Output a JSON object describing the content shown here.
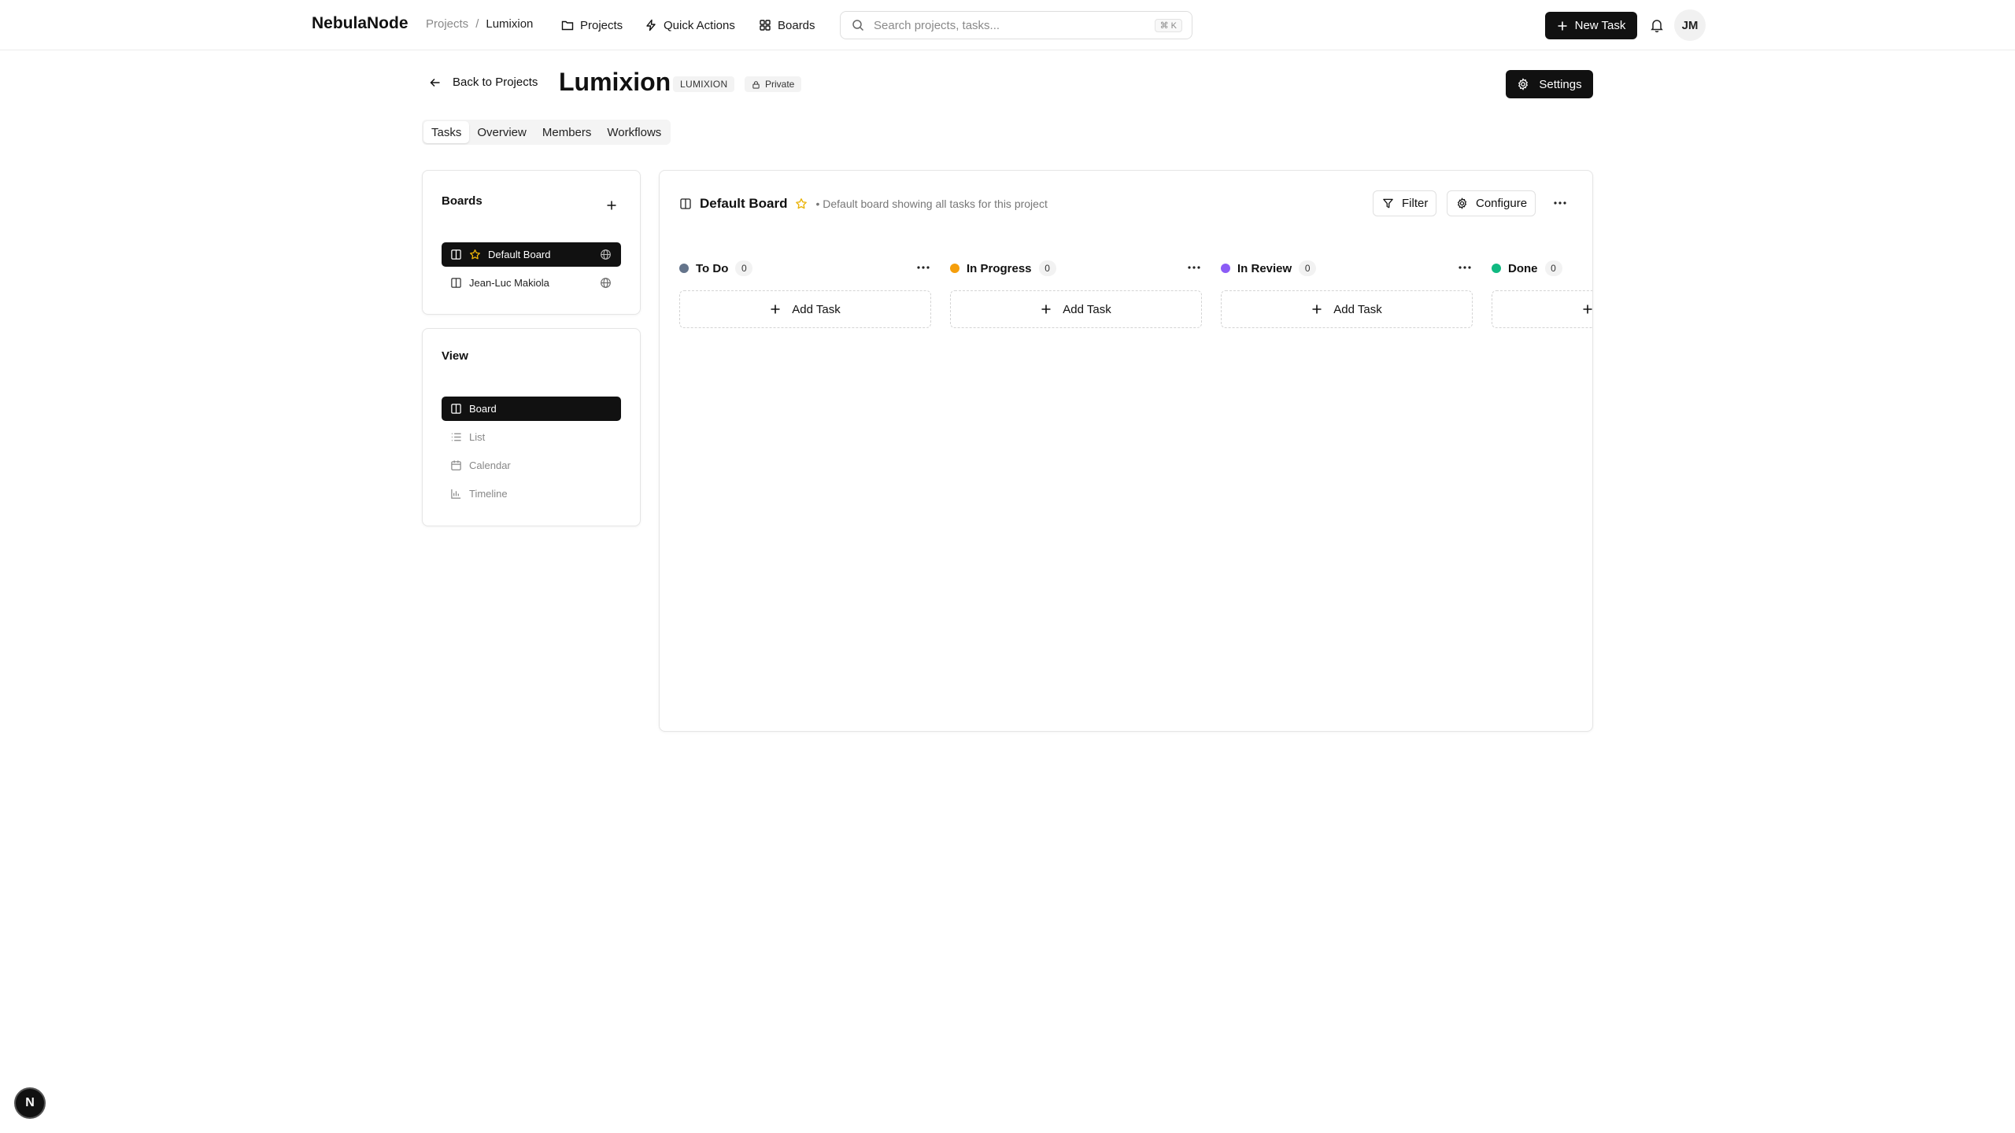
{
  "app": {
    "logo": "NebulaNode",
    "breadcrumb": {
      "parent": "Projects",
      "separator": "/",
      "current": "Lumixion"
    },
    "nav": [
      {
        "label": "Projects",
        "icon": "folder-icon"
      },
      {
        "label": "Quick Actions",
        "icon": "bolt-icon"
      },
      {
        "label": "Boards",
        "icon": "grid-icon"
      }
    ],
    "search": {
      "placeholder": "Search projects, tasks...",
      "shortcut": "⌘ K"
    },
    "new_task_label": "New Task",
    "avatar_initials": "JM"
  },
  "project": {
    "back_label": "Back to Projects",
    "title": "Lumixion",
    "key_badge": "LUMIXION",
    "visibility": "Private",
    "settings_label": "Settings",
    "tabs": [
      "Tasks",
      "Overview",
      "Members",
      "Workflows"
    ],
    "active_tab": "Tasks"
  },
  "sidebar": {
    "boards_title": "Boards",
    "boards": [
      {
        "name": "Default Board",
        "starred": true,
        "active": true
      },
      {
        "name": "Jean-Luc Makiola",
        "starred": false,
        "active": false
      }
    ],
    "view_title": "View",
    "views": [
      {
        "name": "Board",
        "icon": "board-icon",
        "active": true
      },
      {
        "name": "List",
        "icon": "list-icon",
        "active": false
      },
      {
        "name": "Calendar",
        "icon": "calendar-icon",
        "active": false
      },
      {
        "name": "Timeline",
        "icon": "timeline-icon",
        "active": false
      }
    ]
  },
  "board": {
    "name": "Default Board",
    "description": "• Default board showing all tasks for this project",
    "filter_label": "Filter",
    "configure_label": "Configure",
    "add_task_label": "Add Task",
    "columns": [
      {
        "name": "To Do",
        "count": "0",
        "color": "#64748b"
      },
      {
        "name": "In Progress",
        "count": "0",
        "color": "#f59e0b"
      },
      {
        "name": "In Review",
        "count": "0",
        "color": "#8b5cf6"
      },
      {
        "name": "Done",
        "count": "0",
        "color": "#10b981"
      }
    ]
  },
  "fab_label": "N",
  "colors": {
    "primary": "#111111",
    "star": "#eab308",
    "border": "#e5e5e5",
    "muted_text": "#888888"
  }
}
